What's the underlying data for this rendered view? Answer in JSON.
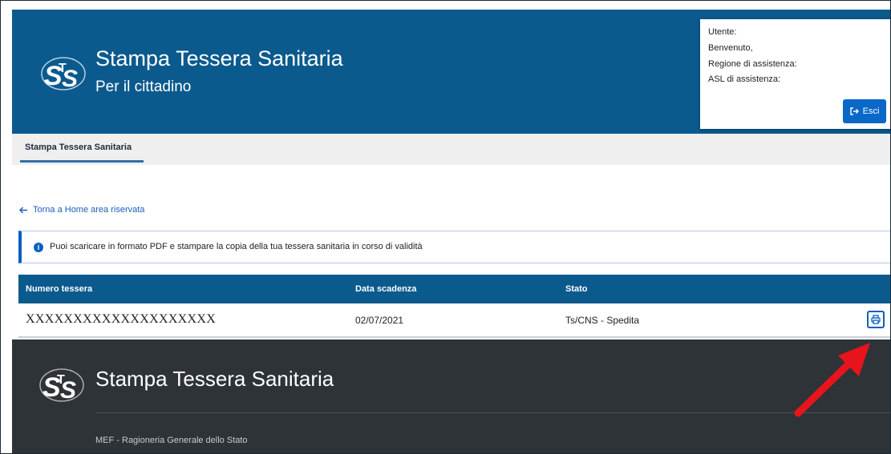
{
  "header": {
    "title": "Stampa Tessera Sanitaria",
    "subtitle": "Per il cittadino",
    "logo_text": "STS",
    "background_color": "#0b5a8e"
  },
  "user_box": {
    "user_label": "Utente:",
    "welcome": "Benvenuto,",
    "region_label": "Regione di assistenza:",
    "asl_label": "ASL di assistenza:",
    "exit_label": "Esci",
    "exit_icon": "sign-out-icon"
  },
  "tabs": [
    {
      "label": "Stampa Tessera Sanitaria",
      "active": true
    }
  ],
  "back_link": {
    "icon": "arrow-left-icon",
    "label": "Torna a Home area riservata"
  },
  "alert": {
    "icon": "info-icon",
    "text": "Puoi scaricare in formato PDF e stampare la copia della tua tessera sanitaria in corso di validità"
  },
  "table": {
    "headers": [
      "Numero tessera",
      "Data scadenza",
      "Stato"
    ],
    "rows": [
      {
        "numero": "XXXXXXXXXXXXXXXXXXXX",
        "scadenza": "02/07/2021",
        "stato": "Ts/CNS - Spedita",
        "action_icon": "printer-icon"
      }
    ],
    "header_color": "#0b5a8e"
  },
  "footer": {
    "title": "Stampa Tessera Sanitaria",
    "subtitle": "MEF - Ragioneria Generale dello Stato",
    "background_color": "#2e3338"
  },
  "annotation": {
    "arrow_color": "#e8141b",
    "points_to": "print button"
  }
}
